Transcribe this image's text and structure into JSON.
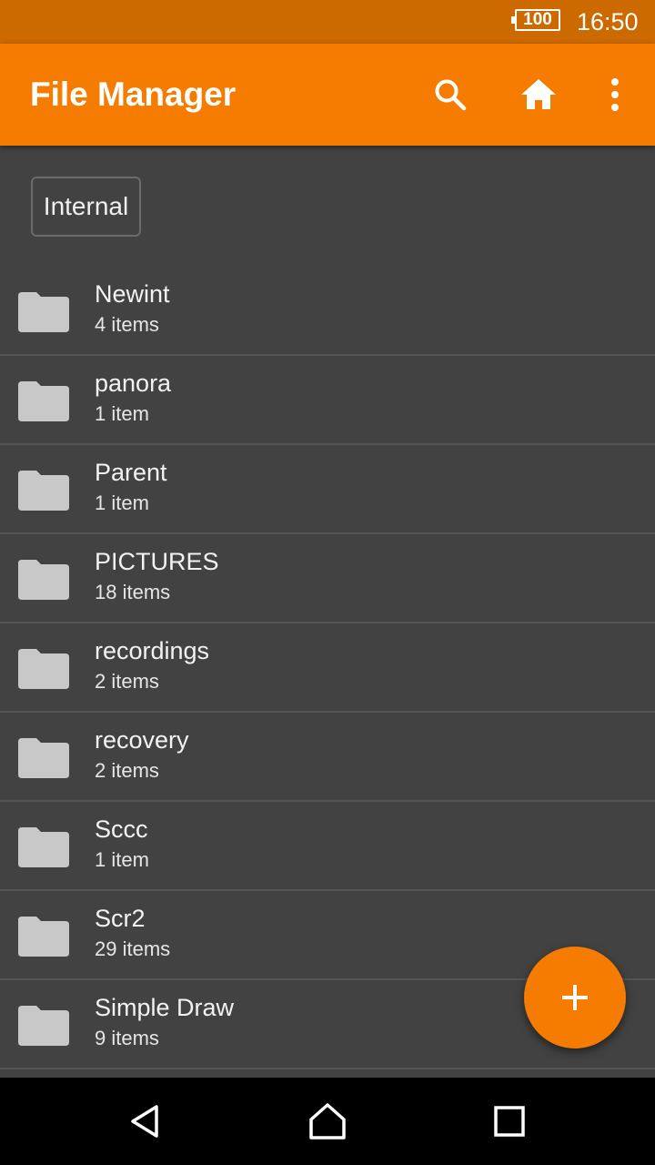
{
  "status_bar": {
    "battery": "100",
    "time": "16:50"
  },
  "app_bar": {
    "title": "File Manager",
    "icons": [
      "search-icon",
      "home-icon",
      "more-vert-icon"
    ]
  },
  "storage_chip": {
    "label": "Internal"
  },
  "folders": [
    {
      "name": "Newint",
      "count": "4 items"
    },
    {
      "name": "panora",
      "count": "1 item"
    },
    {
      "name": "Parent",
      "count": "1 item"
    },
    {
      "name": "PICTURES",
      "count": "18 items"
    },
    {
      "name": "recordings",
      "count": "2 items"
    },
    {
      "name": "recovery",
      "count": "2 items"
    },
    {
      "name": "Sccc",
      "count": "1 item"
    },
    {
      "name": "Scr2",
      "count": "29 items"
    },
    {
      "name": "Simple Draw",
      "count": "9 items"
    }
  ],
  "fab": {
    "icon": "add-icon"
  },
  "nav_bar": {
    "icons": [
      "back-icon",
      "home-nav-icon",
      "recents-icon"
    ]
  },
  "colors": {
    "accent": "#f57c00",
    "status_bar": "#cc6a00",
    "background": "#424242",
    "folder_icon": "#c8c8c8"
  }
}
